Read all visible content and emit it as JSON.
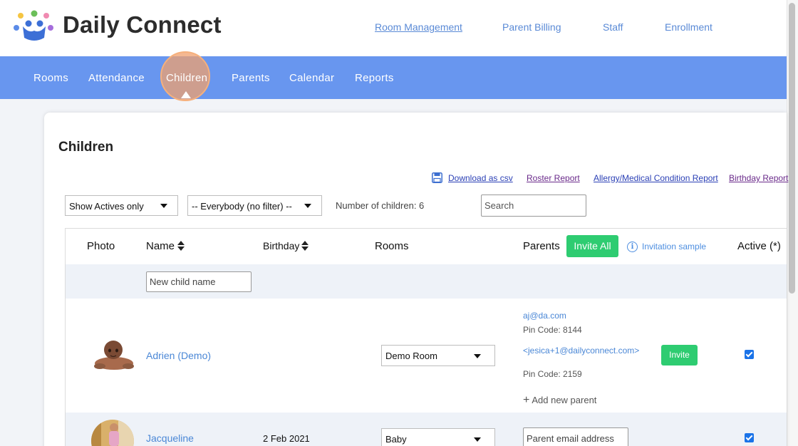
{
  "brand": {
    "name": "Daily Connect"
  },
  "top_links": [
    "Room Management",
    "Parent Billing",
    "Staff",
    "Enrollment"
  ],
  "nav": [
    "Rooms",
    "Attendance",
    "Children",
    "Parents",
    "Calendar",
    "Reports"
  ],
  "active_nav": "Children",
  "page": {
    "title": "Children",
    "download_csv": "Download as csv",
    "roster_report": "Roster Report",
    "allergy_report": "Allergy/Medical Condition Report",
    "birthday_report": "Birthday Report"
  },
  "filters": {
    "status_select": "Show Actives only",
    "group_select": "-- Everybody (no filter) --",
    "count_text": "Number of children: 6",
    "search_placeholder": "Search"
  },
  "table": {
    "headers": {
      "photo": "Photo",
      "name": "Name",
      "birthday": "Birthday",
      "rooms": "Rooms",
      "parents": "Parents",
      "invite_all": "Invite All",
      "invitation_sample": "Invitation sample",
      "active": "Active (*)"
    },
    "new_child_placeholder": "New child name",
    "rows": [
      {
        "name": "Adrien (Demo)",
        "birthday": "",
        "room": "Demo Room",
        "parent1_email": "aj@da.com",
        "parent1_pin": "Pin Code: 8144",
        "parent2_email": "<jesica+1@dailyconnect.com>",
        "parent2_pin": "Pin Code: 2159",
        "invite_label": "Invite",
        "add_parent": "Add new parent",
        "active": true
      },
      {
        "name": "Jacqueline",
        "birthday": "2 Feb 2021",
        "room": "Baby",
        "parent_email_placeholder": "Parent email address",
        "active": true
      }
    ]
  },
  "colors": {
    "nav_bg": "#6896ef",
    "accent_green": "#2ecc71",
    "link_blue": "#4a87d6",
    "highlight": "#f0a06e"
  }
}
